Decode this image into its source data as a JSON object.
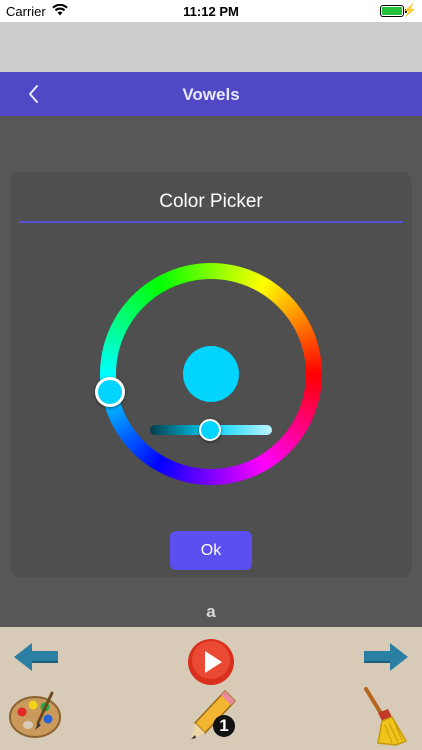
{
  "status_bar": {
    "carrier": "Carrier",
    "time": "11:12 PM"
  },
  "nav": {
    "title": "Vowels",
    "back_icon": "chevron-left-icon"
  },
  "dialog": {
    "title": "Color Picker",
    "ok_label": "Ok",
    "selected_color": "#00d4ff"
  },
  "current_letter": "a",
  "toolbar": {
    "pencil_number": "1",
    "icons": [
      "left-arrow-icon",
      "play-icon",
      "right-arrow-icon",
      "palette-icon",
      "pencil-icon",
      "broom-icon"
    ]
  },
  "colors": {
    "nav_bg": "#5148c6",
    "accent": "#5b4ff0",
    "toolbar_bg": "#d7cbb8",
    "page_bg": "#575757"
  }
}
